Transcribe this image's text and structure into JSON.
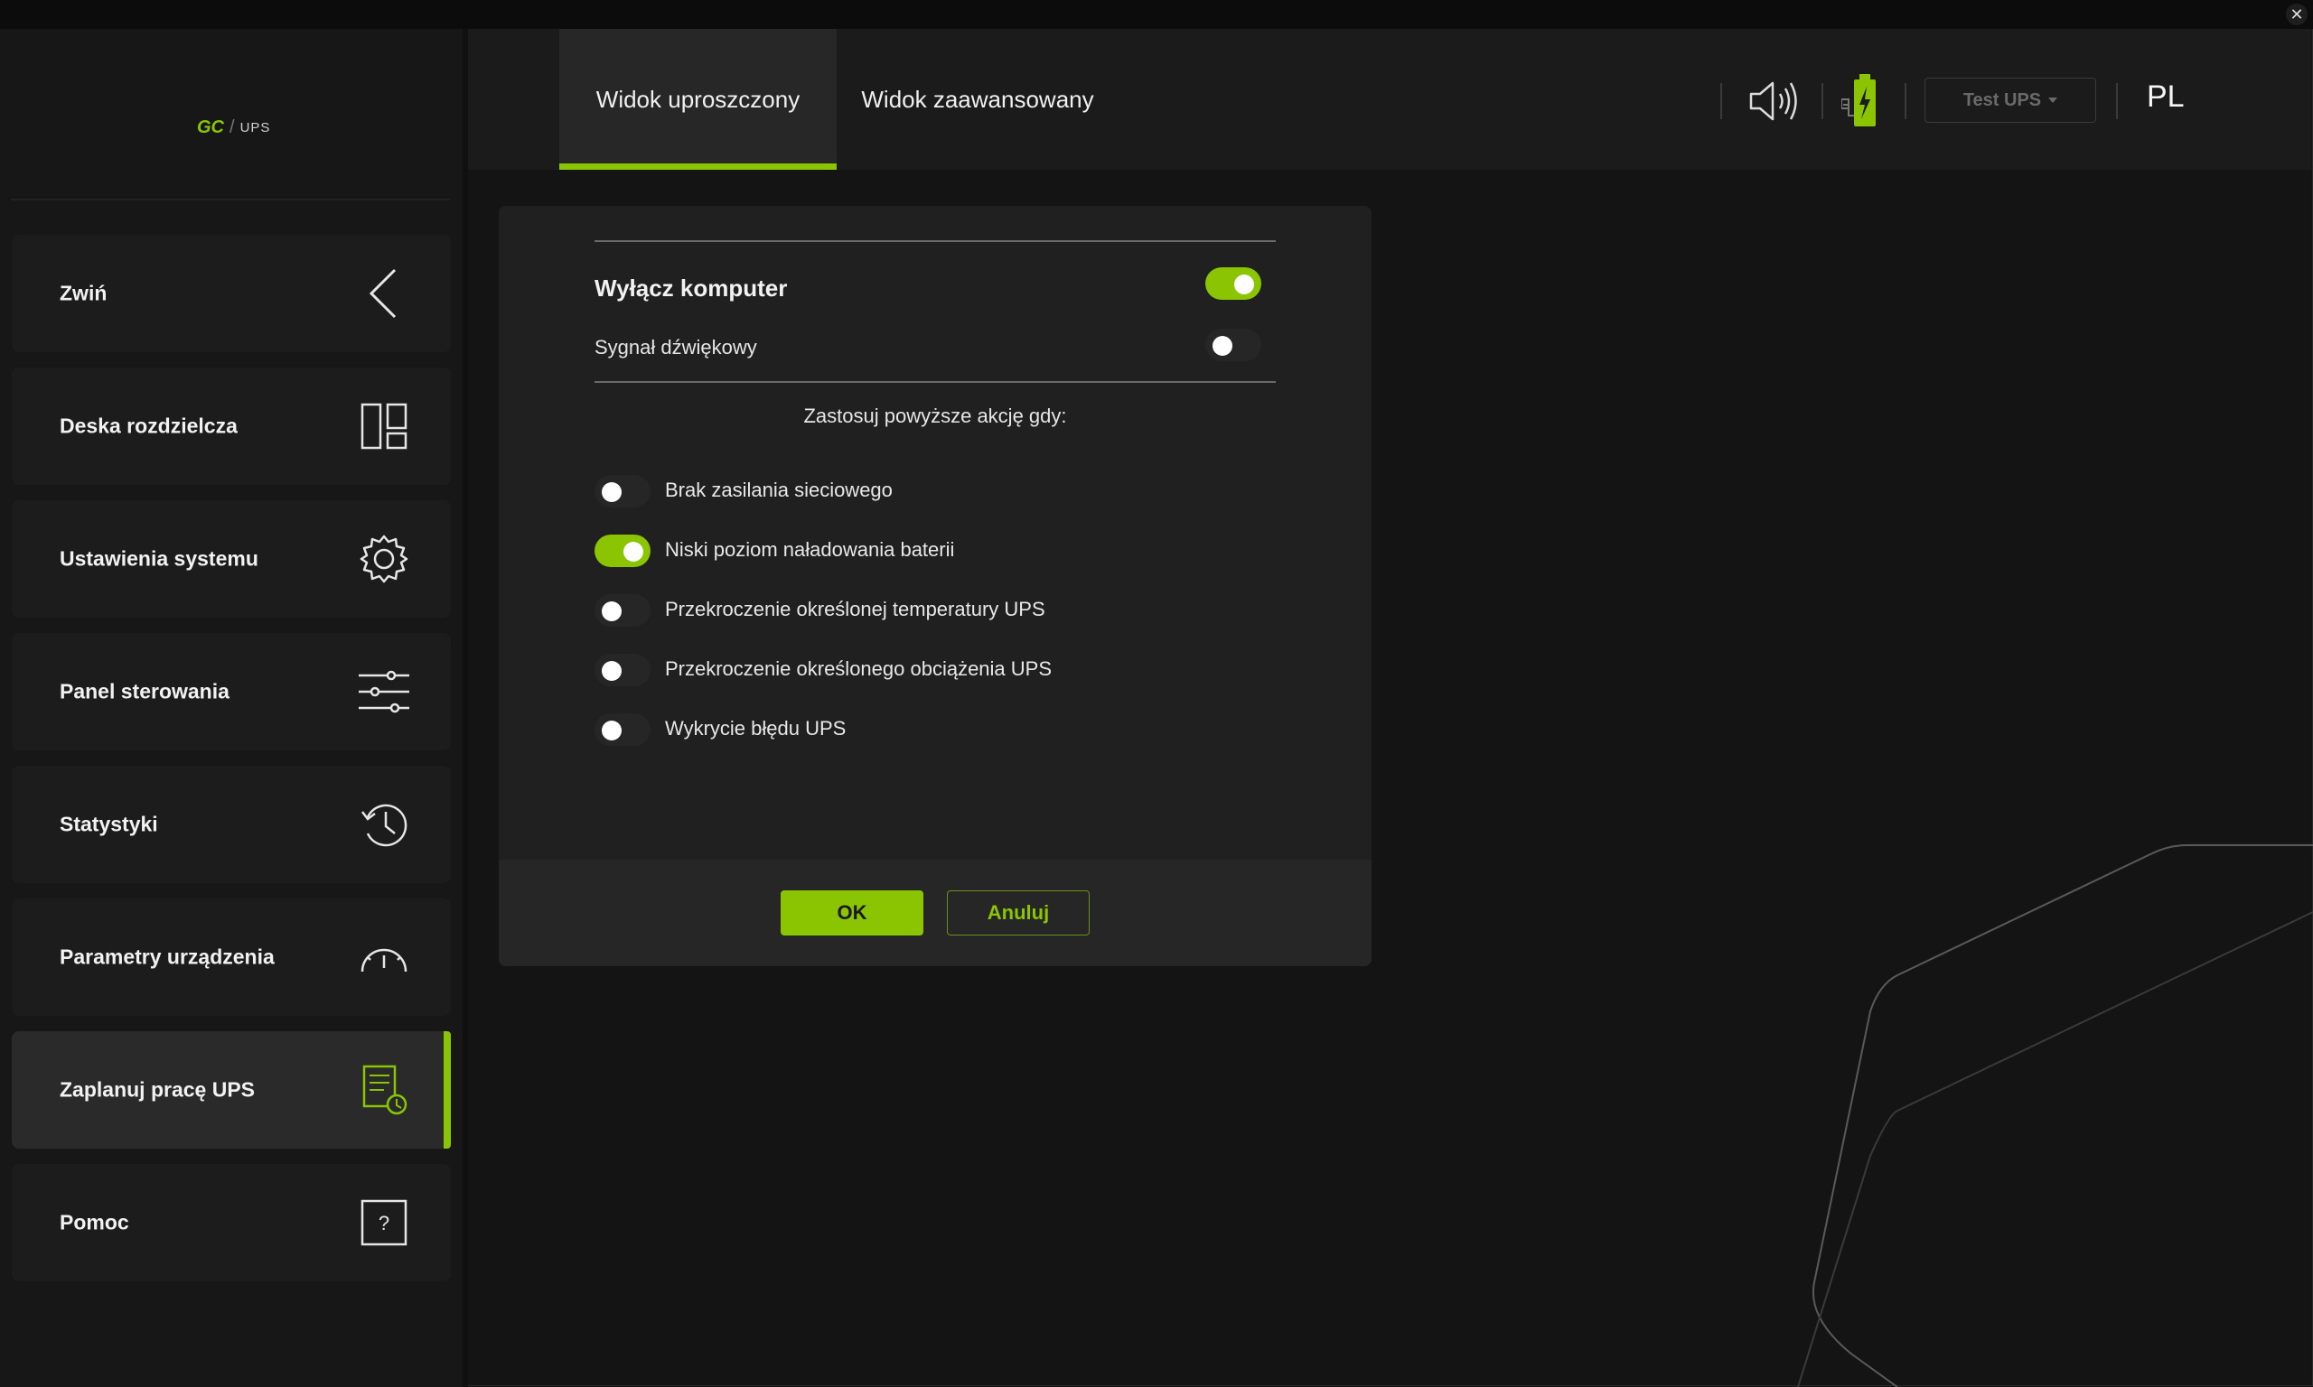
{
  "window": {
    "close_glyph": "✕"
  },
  "logo": {
    "brand": "GC",
    "slash": "/",
    "product": "UPS"
  },
  "sidebar": {
    "items": [
      {
        "label": "Zwiń",
        "icon": "chevron-left-icon"
      },
      {
        "label": "Deska rozdzielcza",
        "icon": "dashboard-grid-icon"
      },
      {
        "label": "Ustawienia systemu",
        "icon": "gear-icon"
      },
      {
        "label": "Panel sterowania",
        "icon": "sliders-icon"
      },
      {
        "label": "Statystyki",
        "icon": "history-clock-icon"
      },
      {
        "label": "Parametry urządzenia",
        "icon": "gauge-icon"
      },
      {
        "label": "Zaplanuj pracę UPS",
        "icon": "schedule-document-icon",
        "active": true
      },
      {
        "label": "Pomoc",
        "icon": "help-box-icon"
      }
    ]
  },
  "header": {
    "tabs": [
      {
        "label": "Widok uproszczony",
        "active": true
      },
      {
        "label": "Widok zaawansowany",
        "active": false
      }
    ],
    "device_select": "Test UPS",
    "language": "PL"
  },
  "dialog": {
    "shutdown_label": "Wyłącz komputer",
    "shutdown_on": true,
    "beep_label": "Sygnał dźwiękowy",
    "beep_on": false,
    "apply_caption": "Zastosuj powyższe akcję gdy:",
    "conditions": [
      {
        "label": "Brak zasilania sieciowego",
        "on": false
      },
      {
        "label": "Niski poziom naładowania baterii",
        "on": true
      },
      {
        "label": "Przekroczenie określonej temperatury UPS",
        "on": false
      },
      {
        "label": "Przekroczenie określonego obciążenia UPS",
        "on": false
      },
      {
        "label": "Wykrycie błędu UPS",
        "on": false
      }
    ],
    "ok_label": "OK",
    "cancel_label": "Anuluj"
  },
  "colors": {
    "accent": "#8bc400",
    "background": "#141414",
    "sidebar": "#171717",
    "panel": "#202020"
  }
}
